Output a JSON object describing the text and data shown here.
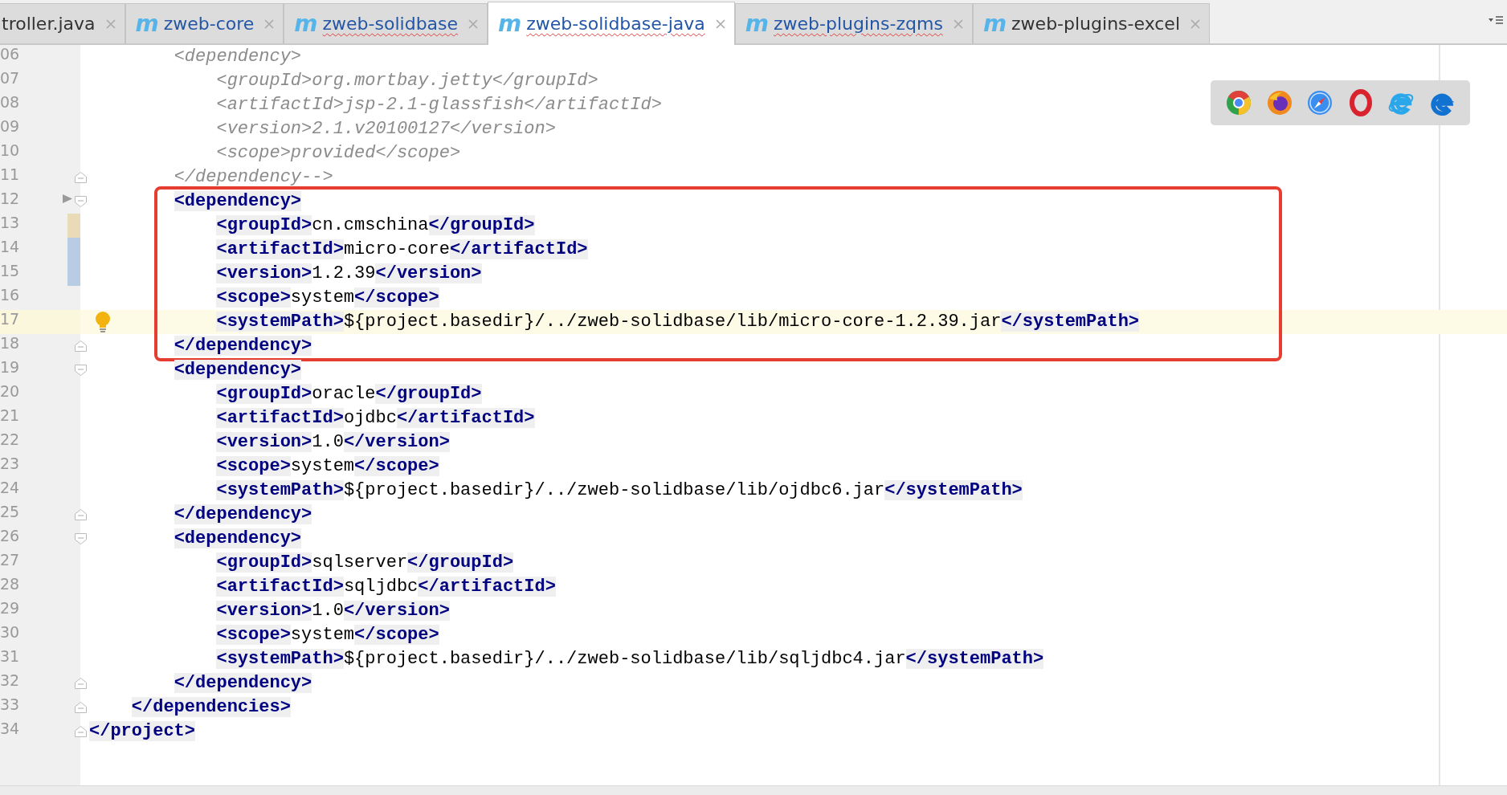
{
  "tabs": [
    {
      "label": "troller.java",
      "selected": false,
      "modified": false,
      "misspelled": false
    },
    {
      "label": "zweb-core",
      "icon": "m",
      "selected": false,
      "modified": true,
      "misspelled": false
    },
    {
      "label": "zweb-solidbase",
      "icon": "m",
      "selected": false,
      "modified": true,
      "misspelled": true
    },
    {
      "label": "zweb-solidbase-java",
      "icon": "m",
      "selected": true,
      "modified": true,
      "misspelled": true
    },
    {
      "label": "zweb-plugins-zqms",
      "icon": "m",
      "selected": false,
      "modified": true,
      "misspelled": true
    },
    {
      "label": "zweb-plugins-excel",
      "icon": "m",
      "selected": false,
      "modified": false,
      "misspelled": false
    }
  ],
  "editor": {
    "lines": [
      {
        "number": "06",
        "text": "        <dependency>",
        "comment": true,
        "current": false
      },
      {
        "number": "07",
        "text": "            <groupId>org.mortbay.jetty</groupId>",
        "comment": true,
        "current": false
      },
      {
        "number": "08",
        "text": "            <artifactId>jsp-2.1-glassfish</artifactId>",
        "comment": true,
        "current": false
      },
      {
        "number": "09",
        "text": "            <version>2.1.v20100127</version>",
        "comment": true,
        "current": false
      },
      {
        "number": "10",
        "text": "            <scope>provided</scope>",
        "comment": true,
        "current": false
      },
      {
        "number": "11",
        "text": "        </dependency-->",
        "comment": true,
        "current": false,
        "gutter_icons": [
          {
            "kind": "fold_end"
          }
        ]
      }
    ],
    "highlighted_lines": [
      {
        "number": "12",
        "text": "        <dependency>",
        "comment": false,
        "current": false,
        "gutter_icons": [
          {
            "kind": "arrow"
          },
          {
            "kind": "fold_start"
          }
        ]
      },
      {
        "number": "13",
        "text": "            <groupId>cn.cmschina</groupId>",
        "comment": false,
        "current": false,
        "gutter_icons": [
          {
            "kind": "change",
            "color": "#eadbb8"
          }
        ]
      },
      {
        "number": "14",
        "text": "            <artifactId>micro-core</artifactId>",
        "comment": false,
        "current": false,
        "gutter_icons": [
          {
            "kind": "change",
            "color": "#b8cde4"
          }
        ]
      },
      {
        "number": "15",
        "text": "            <version>1.2.39</version>",
        "comment": false,
        "current": false,
        "gutter_icons": [
          {
            "kind": "change",
            "color": "#b8cde4"
          }
        ]
      },
      {
        "number": "16",
        "text": "            <scope>system</scope>",
        "comment": false,
        "current": false
      },
      {
        "number": "17",
        "text": "            <systemPath>${project.basedir}/../zweb-solidbase/lib/micro-core-1.2.39.jar</systemPath>",
        "comment": false,
        "current": true,
        "gutter_icons": [
          {
            "kind": "bulb"
          }
        ]
      },
      {
        "number": "18",
        "text": "        </dependency>",
        "comment": false,
        "current": false,
        "gutter_icons": [
          {
            "kind": "fold_end"
          }
        ]
      }
    ],
    "lines_after": [
      {
        "number": "19",
        "text": "        <dependency>",
        "comment": false,
        "current": false,
        "gutter_icons": [
          {
            "kind": "fold_start"
          }
        ]
      },
      {
        "number": "20",
        "text": "            <groupId>oracle</groupId>",
        "comment": false,
        "current": false
      },
      {
        "number": "21",
        "text": "            <artifactId>ojdbc</artifactId>",
        "comment": false,
        "current": false
      },
      {
        "number": "22",
        "text": "            <version>1.0</version>",
        "comment": false,
        "current": false
      },
      {
        "number": "23",
        "text": "            <scope>system</scope>",
        "comment": false,
        "current": false
      },
      {
        "number": "24",
        "text": "            <systemPath>${project.basedir}/../zweb-solidbase/lib/ojdbc6.jar</systemPath>",
        "comment": false,
        "current": false
      },
      {
        "number": "25",
        "text": "        </dependency>",
        "comment": false,
        "current": false,
        "gutter_icons": [
          {
            "kind": "fold_end"
          }
        ]
      },
      {
        "number": "26",
        "text": "        <dependency>",
        "comment": false,
        "current": false,
        "gutter_icons": [
          {
            "kind": "fold_start"
          }
        ]
      },
      {
        "number": "27",
        "text": "            <groupId>sqlserver</groupId>",
        "comment": false,
        "current": false
      },
      {
        "number": "28",
        "text": "            <artifactId>sqljdbc</artifactId>",
        "comment": false,
        "current": false
      },
      {
        "number": "29",
        "text": "            <version>1.0</version>",
        "comment": false,
        "current": false
      },
      {
        "number": "30",
        "text": "            <scope>system</scope>",
        "comment": false,
        "current": false
      },
      {
        "number": "31",
        "text": "            <systemPath>${project.basedir}/../zweb-solidbase/lib/sqljdbc4.jar</systemPath>",
        "comment": false,
        "current": false
      },
      {
        "number": "32",
        "text": "        </dependency>",
        "comment": false,
        "current": false,
        "gutter_icons": [
          {
            "kind": "fold_end"
          }
        ]
      },
      {
        "number": "33",
        "text": "    </dependencies>",
        "comment": false,
        "current": false,
        "gutter_icons": [
          {
            "kind": "fold_end"
          }
        ]
      },
      {
        "number": "34",
        "text": "</project>",
        "comment": false,
        "current": false,
        "gutter_icons": [
          {
            "kind": "fold_end"
          }
        ]
      }
    ]
  },
  "browser_bar": {
    "icons": [
      {
        "kind": "chrome"
      },
      {
        "kind": "firefox"
      },
      {
        "kind": "safari"
      },
      {
        "kind": "opera"
      },
      {
        "kind": "ie"
      },
      {
        "kind": "edge"
      }
    ]
  }
}
